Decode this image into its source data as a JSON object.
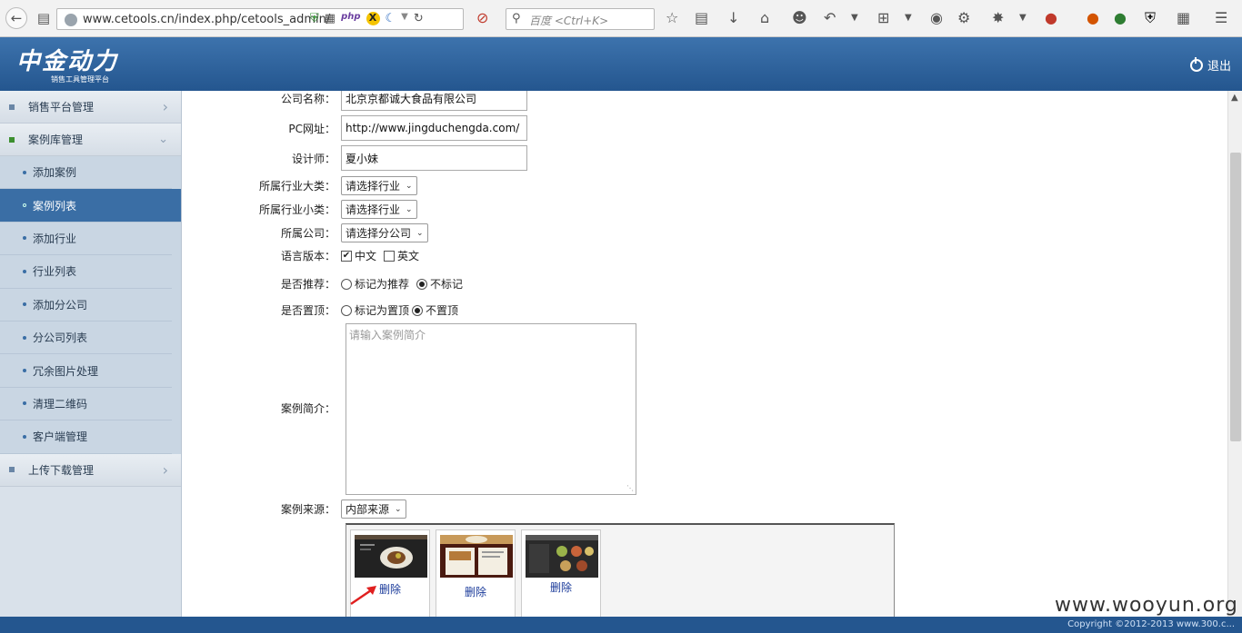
{
  "browser": {
    "url": "www.cetools.cn/index.php/cetools_admin/",
    "search_placeholder": "百度 <Ctrl+K>"
  },
  "header": {
    "logo_main": "中金动力",
    "logo_sub": "销售工具管理平台",
    "logout_label": "退出"
  },
  "sidebar": {
    "group_sales": "销售平台管理",
    "group_cases": "案例库管理",
    "items": [
      "添加案例",
      "案例列表",
      "添加行业",
      "行业列表",
      "添加分公司",
      "分公司列表",
      "冗余图片处理",
      "清理二维码",
      "客户端管理"
    ],
    "active_index": 1,
    "group_upload": "上传下载管理"
  },
  "form": {
    "company_label": "公司名称：",
    "company_value": "北京京都诚大食品有限公司",
    "pc_url_label": "PC网址：",
    "pc_url_value": "http://www.jingduchengda.com/",
    "designer_label": "设计师：",
    "designer_value": "夏小妹",
    "industry_major_label": "所属行业大类：",
    "industry_major_value": "请选择行业",
    "industry_minor_label": "所属行业小类：",
    "industry_minor_value": "请选择行业",
    "branch_label": "所属公司：",
    "branch_value": "请选择分公司",
    "language_label": "语言版本：",
    "lang_cn": "中文",
    "lang_en": "英文",
    "recommend_label": "是否推荐：",
    "recommend_yes": "标记为推荐",
    "recommend_no": "不标记",
    "top_label": "是否置顶：",
    "top_yes": "标记为置顶",
    "top_no": "不置顶",
    "intro_label": "案例简介：",
    "intro_placeholder": "请输入案例简介",
    "source_label": "案例来源：",
    "source_value": "内部来源",
    "delete_label": "删除"
  },
  "footer": {
    "watermark": "www.wooyun.org",
    "copyright": "Copyright ©2012-2013 www.300.c..."
  }
}
